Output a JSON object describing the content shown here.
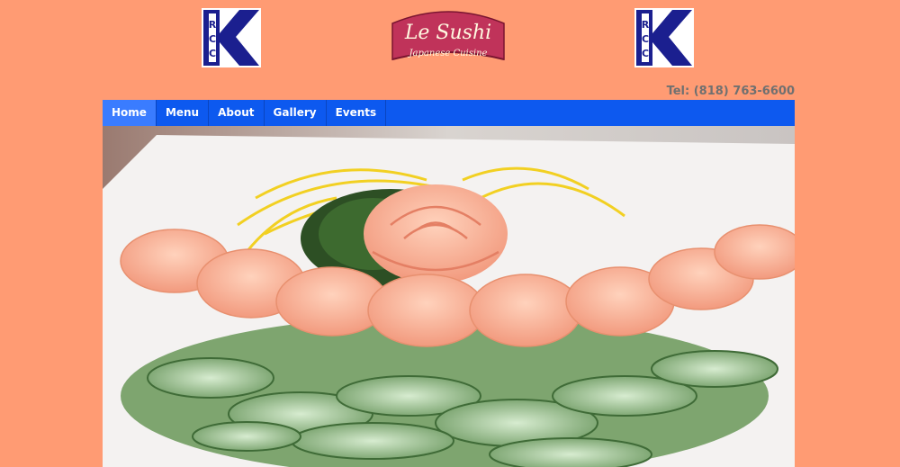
{
  "header": {
    "brand_name": "Le Sushi",
    "brand_tagline": "Japanese Cuisine",
    "logo_mark_text": "RCC",
    "phone": "Tel: (818) 763-6600"
  },
  "nav": {
    "items": [
      {
        "label": "Home",
        "active": true
      },
      {
        "label": "Menu"
      },
      {
        "label": "About"
      },
      {
        "label": "Gallery"
      },
      {
        "label": "Events"
      }
    ]
  },
  "colors": {
    "page_background": "#ff9b73",
    "nav_background": "#0d59ef",
    "nav_active": "#3a7cff",
    "brand_red": "#c0335a",
    "logo_blue": "#1b1f8f"
  },
  "hero": {
    "image_subject": "plated salmon rose with seared salmon pieces on sliced cucumber"
  }
}
